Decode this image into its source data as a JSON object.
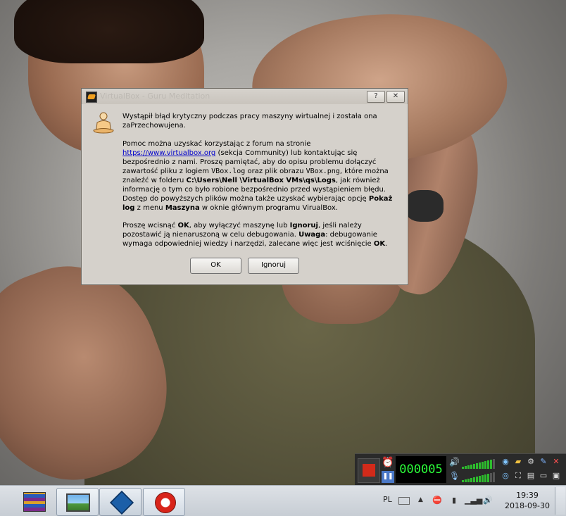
{
  "dialog": {
    "title": "VirtualBox - Guru Meditation",
    "help_label": "?",
    "close_label": "✕",
    "p1": "Wystąpił błąd krytyczny podczas pracy maszyny wirtualnej i została ona zaPrzechowujena.",
    "p2": {
      "t1": "Pomoc można uzyskać korzystając z forum na stronie ",
      "link": "https://www.virtualbox.org",
      "t2": " (sekcja Community) lub kontaktując się bezpośrednio z nami. Proszę pamiętać, aby do opisu problemu dołączyć zawartość pliku z logiem ",
      "log_file": "VBox.log",
      "t3": " oraz plik obrazu ",
      "png_file": "VBox.png",
      "t4": ", które można znaleźć w folderu ",
      "path": "C:\\Users\\Nell \\VirtualBox VMs\\qs\\Logs",
      "t5": ", jak również informację o tym co było robione bezpośrednio przed wystąpieniem błędu. Dostęp do powyższych plików można także uzyskać wybierając opcję ",
      "show_log": "Pokaż log",
      "t6": " z menu ",
      "machine": "Maszyna",
      "t7": " w oknie głównym programu VirualBox."
    },
    "p3": {
      "t1": "Proszę wcisnąć ",
      "ok": "OK",
      "t2": ", aby wyłączyć maszynę lub ",
      "ignore": "Ignoruj",
      "t3": ", jeśli należy pozostawić ją nienaruszoną w celu debugowania. ",
      "warning": "Uwaga",
      "t4": ": debugowanie wymaga odpowiedniej wiedzy i narzędzi, zalecane więc jest wciśnięcie ",
      "ok2": "OK",
      "t5": "."
    },
    "ok_button": "OK",
    "ignore_button": "Ignoruj"
  },
  "recorder": {
    "timer": "000005",
    "audio_level": 0.85,
    "mic_level": 0.8
  },
  "taskbar": {
    "language": "PL",
    "time": "19:39",
    "date": "2018-09-30"
  },
  "colors": {
    "dialog_bg": "#d5d1cb",
    "link": "#0000cc",
    "timer_green": "#2cff3a",
    "record_red": "#d22a1a"
  }
}
